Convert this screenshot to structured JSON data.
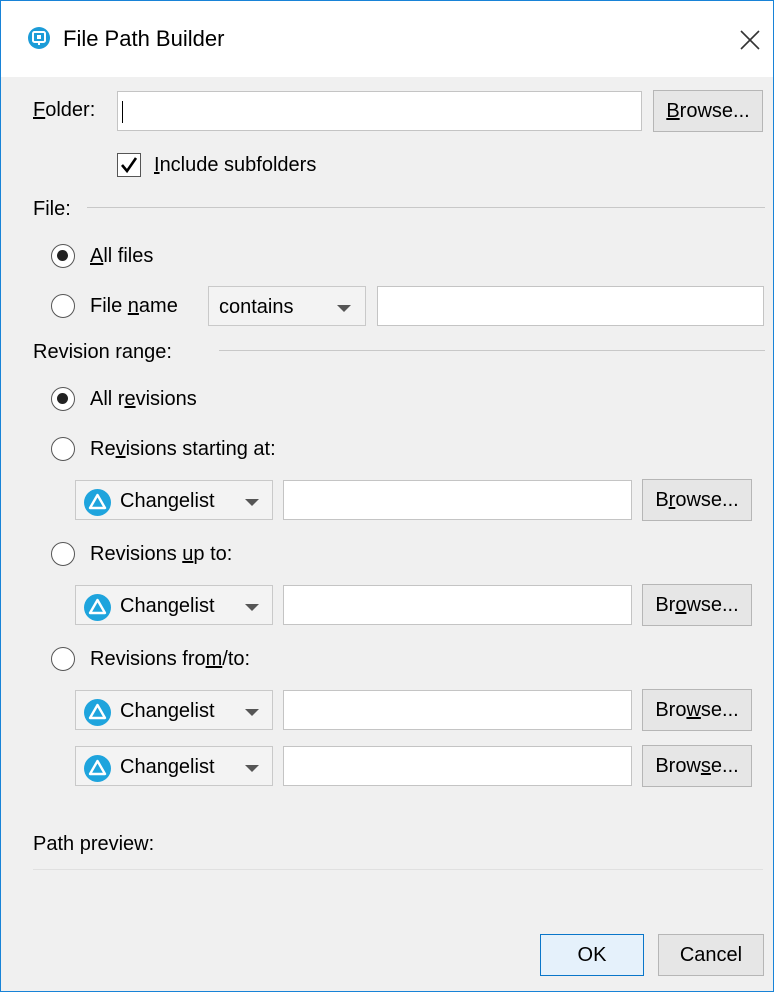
{
  "window": {
    "title": "File Path Builder"
  },
  "folder": {
    "label": "Folder:",
    "value": "",
    "browse": "Browse...",
    "include_subfolders": {
      "label": "Include subfolders",
      "checked": true
    }
  },
  "file": {
    "section_label": "File:",
    "all_files": {
      "label": "All files",
      "selected": true
    },
    "file_name": {
      "label": "File name",
      "selected": false,
      "operator": "contains",
      "value": ""
    }
  },
  "revision_range": {
    "section_label": "Revision range:",
    "all_revisions": {
      "label": "All revisions",
      "selected": true
    },
    "starting_at": {
      "label": "Revisions starting at:",
      "selected": false,
      "type": "Changelist",
      "value": "",
      "browse": "Browse..."
    },
    "up_to": {
      "label": "Revisions up to:",
      "selected": false,
      "type": "Changelist",
      "value": "",
      "browse": "Browse..."
    },
    "from_to": {
      "label": "Revisions from/to:",
      "selected": false,
      "from": {
        "type": "Changelist",
        "value": "",
        "browse": "Browse..."
      },
      "to": {
        "type": "Changelist",
        "value": "",
        "browse": "Browse..."
      }
    }
  },
  "path_preview": {
    "label": "Path preview:",
    "value": ""
  },
  "buttons": {
    "ok": "OK",
    "cancel": "Cancel"
  },
  "colors": {
    "accent": "#1883d7",
    "changelist_icon": "#1ea4dd",
    "dialog_bg": "#f0f0f0"
  }
}
